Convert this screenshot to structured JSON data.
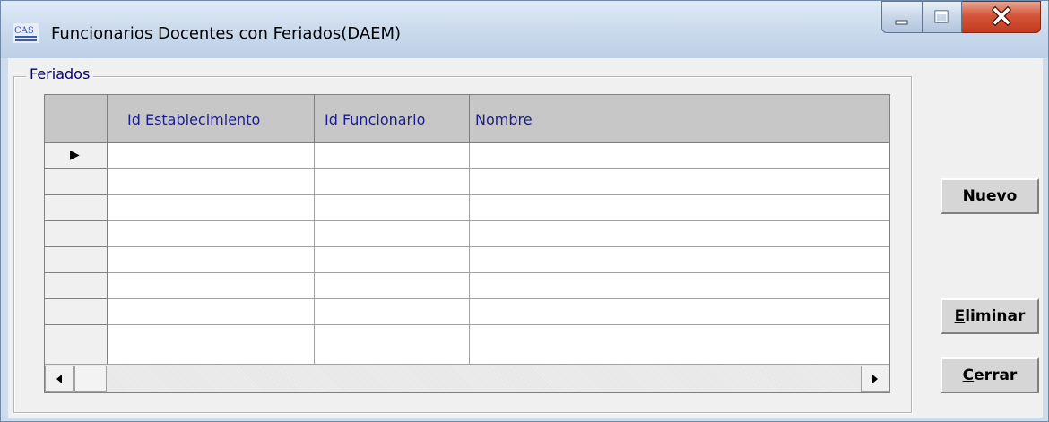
{
  "window": {
    "title": "Funcionarios Docentes con Feriados(DAEM)",
    "app_icon_text": "CAS",
    "accent": "#c43b1f"
  },
  "group": {
    "label": "Feriados"
  },
  "grid": {
    "columns": [
      "Id Establecimiento",
      "Id Funcionario",
      "Nombre"
    ],
    "current_row_marker": "▶",
    "rows": [
      [
        "",
        "",
        ""
      ],
      [
        "",
        "",
        ""
      ],
      [
        "",
        "",
        ""
      ],
      [
        "",
        "",
        ""
      ],
      [
        "",
        "",
        ""
      ],
      [
        "",
        "",
        ""
      ],
      [
        "",
        "",
        ""
      ],
      [
        "",
        "",
        ""
      ]
    ]
  },
  "buttons": {
    "nuevo": {
      "mnemonic": "N",
      "rest": "uevo"
    },
    "eliminar": {
      "mnemonic": "E",
      "rest": "liminar"
    },
    "cerrar": {
      "mnemonic": "C",
      "rest": "errar"
    }
  }
}
